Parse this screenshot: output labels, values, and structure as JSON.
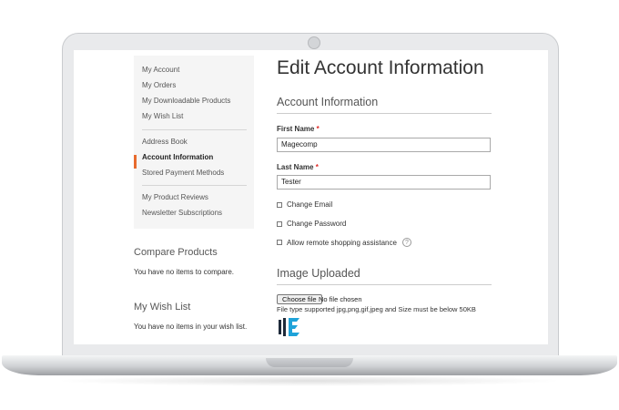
{
  "sidebar": {
    "items": [
      {
        "label": "My Account"
      },
      {
        "label": "My Orders"
      },
      {
        "label": "My Downloadable Products"
      },
      {
        "label": "My Wish List"
      },
      {
        "label": "Address Book"
      },
      {
        "label": "Account Information",
        "active": true
      },
      {
        "label": "Stored Payment Methods"
      },
      {
        "label": "My Product Reviews"
      },
      {
        "label": "Newsletter Subscriptions"
      }
    ]
  },
  "compare": {
    "title": "Compare Products",
    "empty_text": "You have no items to compare."
  },
  "wishlist": {
    "title": "My Wish List",
    "empty_text": "You have no items in your wish list."
  },
  "main": {
    "title": "Edit Account Information",
    "section_title": "Account Information",
    "first_name": {
      "label": "First Name",
      "required_mark": "*",
      "value": "Magecomp"
    },
    "last_name": {
      "label": "Last Name",
      "required_mark": "*",
      "value": "Tester"
    },
    "checkboxes": [
      {
        "label": "Change Email",
        "checked": false
      },
      {
        "label": "Change Password",
        "checked": false
      },
      {
        "label": "Allow remote shopping assistance",
        "checked": false
      }
    ],
    "help_icon_glyph": "?",
    "image_section_title": "Image Uploaded",
    "file_button_label": "Choose file",
    "file_status": "No file chosen",
    "file_hint": "File type supported jpg,png,gif,jpeg and Size must be below 50KB"
  },
  "colors": {
    "accent": "#e86b2e",
    "required": "#e02b27",
    "logo_dark": "#1e2a3a",
    "logo_blue": "#1fa3d9"
  }
}
